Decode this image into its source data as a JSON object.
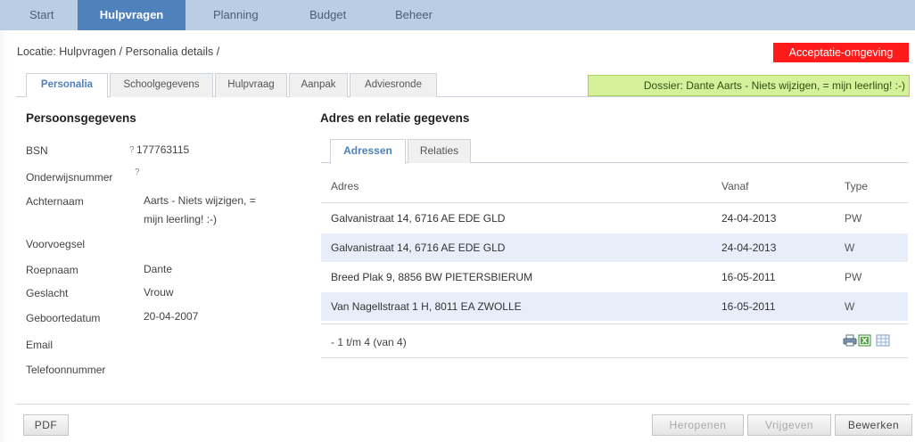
{
  "nav": {
    "items": [
      {
        "label": "Start"
      },
      {
        "label": "Hulpvragen",
        "active": true
      },
      {
        "label": "Planning"
      },
      {
        "label": "Budget"
      },
      {
        "label": "Beheer"
      }
    ]
  },
  "breadcrumb": "Locatie: Hulpvragen / Personalia details /",
  "environment_badge": "Acceptatie-omgeving",
  "tabs": [
    {
      "label": "Personalia",
      "active": true
    },
    {
      "label": "Schoolgegevens"
    },
    {
      "label": "Hulpvraag"
    },
    {
      "label": "Aanpak"
    },
    {
      "label": "Adviesronde"
    }
  ],
  "dossier": "Dossier: Dante Aarts - Niets wijzigen, = mijn leerling! :-)",
  "persoon": {
    "title": "Persoonsgegevens",
    "help_mark": "?",
    "fields": [
      {
        "label": "BSN",
        "value": "177763115"
      },
      {
        "label": "Onderwijsnummer",
        "value": ""
      },
      {
        "label": "Achternaam",
        "value_line1": "Aarts - Niets wijzigen, =",
        "value_line2": "mijn leerling! :-)"
      },
      {
        "label": "Voorvoegsel",
        "value": ""
      },
      {
        "label": "Roepnaam",
        "value": "Dante"
      },
      {
        "label": "Geslacht",
        "value": "Vrouw"
      },
      {
        "label": "Geboortedatum",
        "value": "20-04-2007"
      },
      {
        "label": "Email",
        "value": ""
      },
      {
        "label": "Telefoonnummer",
        "value": ""
      }
    ]
  },
  "adres": {
    "title": "Adres en relatie gegevens",
    "subtabs": [
      {
        "label": "Adressen",
        "active": true
      },
      {
        "label": "Relaties"
      }
    ],
    "columns": [
      "Adres",
      "Vanaf",
      "Type"
    ],
    "rows": [
      {
        "adres": "Galvanistraat 14, 6716 AE EDE GLD",
        "vanaf": "24-04-2013",
        "type": "PW"
      },
      {
        "adres": "Galvanistraat 14, 6716 AE EDE GLD",
        "vanaf": "24-04-2013",
        "type": "W"
      },
      {
        "adres": "Breed Plak 9, 8856 BW PIETERSBIERUM",
        "vanaf": "16-05-2011",
        "type": "PW"
      },
      {
        "adres": "Van Nagellstraat 1 H, 8011 EA ZWOLLE",
        "vanaf": "16-05-2011",
        "type": "W"
      }
    ],
    "pager": "- 1 t/m 4 (van 4)",
    "tool_icons": [
      "printer-icon",
      "excel-icon",
      "table-icon"
    ]
  },
  "buttons": {
    "pdf": "PDF",
    "heropenen": "Heropenen",
    "vrijgeven": "Vrijgeven",
    "bewerken": "Bewerken"
  },
  "colors": {
    "nav_bg": "#b9cde5",
    "nav_active": "#4f81bd",
    "badge": "#ff1b1b",
    "dossier_bg": "#d5f29b",
    "row_alt": "#e8eef9"
  }
}
